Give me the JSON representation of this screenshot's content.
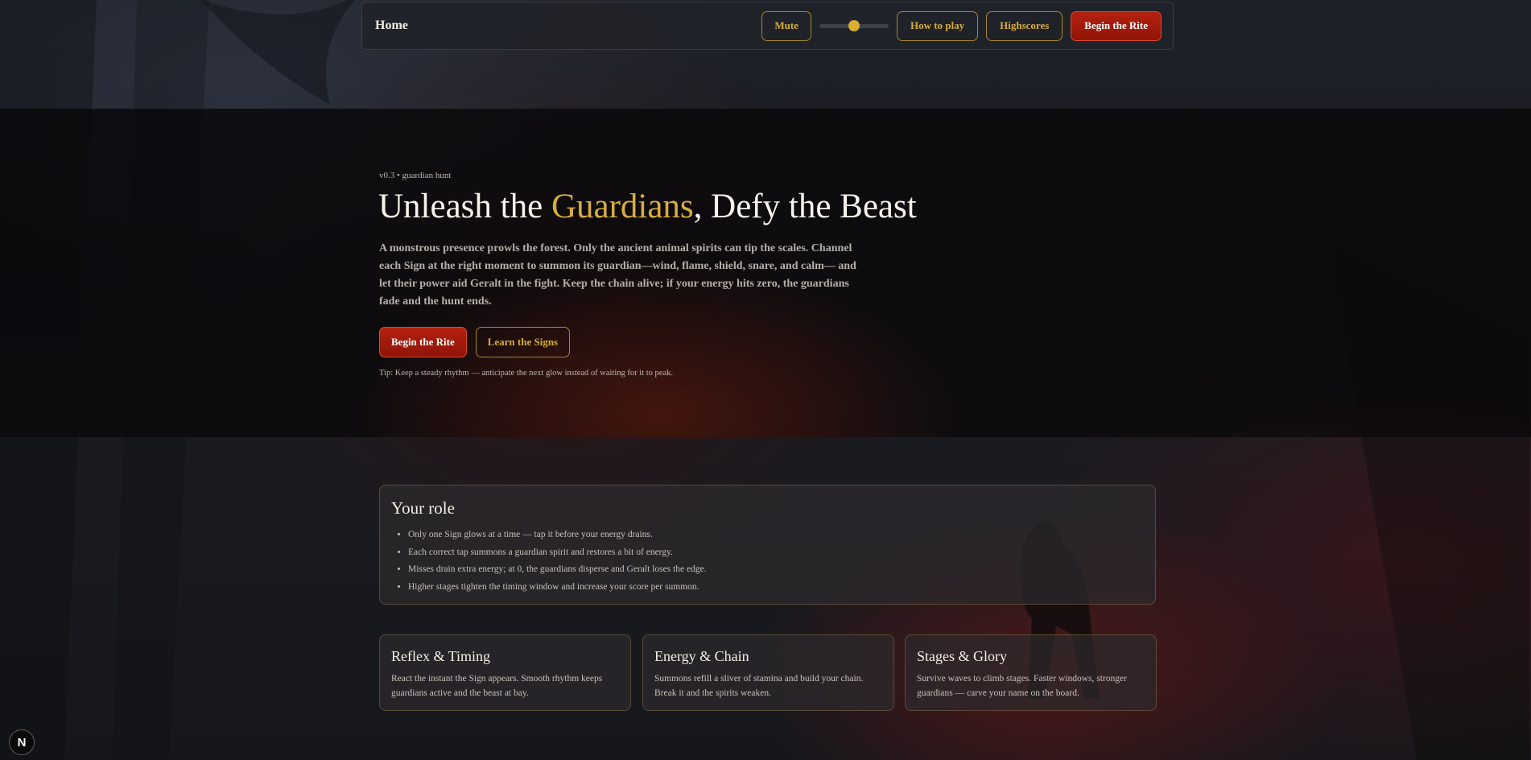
{
  "nav": {
    "home": "Home",
    "mute_label": "Mute",
    "volume": 0.5,
    "how_to_play": "How to play",
    "highscores": "Highscores",
    "begin": "Begin the Rite"
  },
  "hero": {
    "version": "v0.3 • guardian hunt",
    "title_pre": "Unleash the ",
    "title_accent": "Guardians",
    "title_post": ", Defy the Beast",
    "description": "A monstrous presence prowls the forest. Only the ancient animal spirits can tip the scales. Channel each Sign at the right moment to summon its guardian—wind, flame, shield, snare, and calm— and let their power aid Geralt in the fight. Keep the chain alive; if your energy hits zero, the guardians fade and the hunt ends.",
    "primary_cta": "Begin the Rite",
    "secondary_cta": "Learn the Signs",
    "tip": "Tip: Keep a steady rhythm — anticipate the next glow instead of waiting for it to peak."
  },
  "role": {
    "title": "Your role",
    "items": [
      "Only one Sign glows at a time — tap it before your energy drains.",
      "Each correct tap summons a guardian spirit and restores a bit of energy.",
      "Misses drain extra energy; at 0, the guardians disperse and Geralt loses the edge.",
      "Higher stages tighten the timing window and increase your score per summon."
    ]
  },
  "features": [
    {
      "title": "Reflex & Timing",
      "text": "React the instant the Sign appears. Smooth rhythm keeps guardians active and the beast at bay."
    },
    {
      "title": "Energy & Chain",
      "text": "Summons refill a sliver of stamina and build your chain. Break it and the spirits weaken."
    },
    {
      "title": "Stages & Glory",
      "text": "Survive waves to climb stages. Faster windows, stronger guardians — carve your name on the board."
    }
  ],
  "badge": "N",
  "colors": {
    "accent": "#d8ad40",
    "primary": "#b5200f"
  }
}
